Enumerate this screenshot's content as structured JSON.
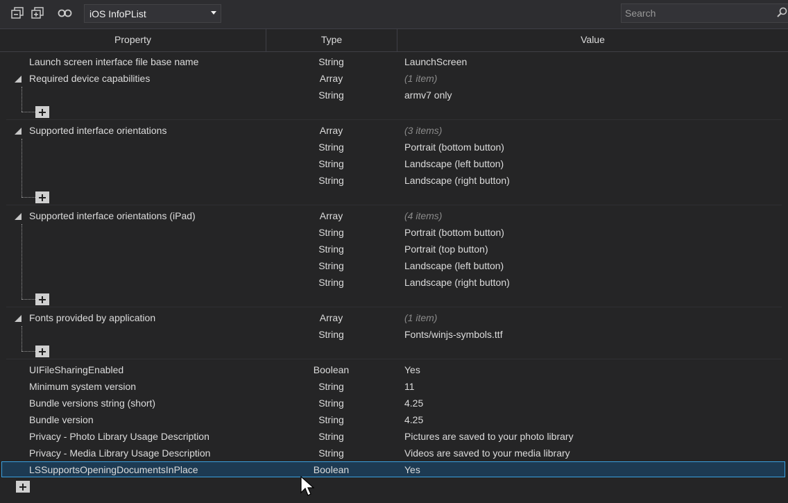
{
  "toolbar": {
    "icons": [
      "collapse-all-icon",
      "expand-all-icon",
      "entitlements-icon"
    ],
    "dropdown_value": "iOS InfoPList",
    "search_placeholder": "Search"
  },
  "columns": {
    "property": "Property",
    "type": "Type",
    "value": "Value"
  },
  "rows": {
    "r0": {
      "property": "Launch screen interface file base name",
      "type": "String",
      "value": "LaunchScreen"
    },
    "r1": {
      "property": "Required device capabilities",
      "type": "Array",
      "value": "(1 item)"
    },
    "r2": {
      "property": "",
      "type": "String",
      "value": "armv7 only"
    },
    "r3": {
      "property": "Supported interface orientations",
      "type": "Array",
      "value": "(3 items)"
    },
    "r4": {
      "property": "",
      "type": "String",
      "value": "Portrait (bottom button)"
    },
    "r5": {
      "property": "",
      "type": "String",
      "value": "Landscape (left button)"
    },
    "r6": {
      "property": "",
      "type": "String",
      "value": "Landscape (right button)"
    },
    "r7": {
      "property": "Supported interface orientations (iPad)",
      "type": "Array",
      "value": "(4 items)"
    },
    "r8": {
      "property": "",
      "type": "String",
      "value": "Portrait (bottom button)"
    },
    "r9": {
      "property": "",
      "type": "String",
      "value": "Portrait (top button)"
    },
    "r10": {
      "property": "",
      "type": "String",
      "value": "Landscape (left button)"
    },
    "r11": {
      "property": "",
      "type": "String",
      "value": "Landscape (right button)"
    },
    "r12": {
      "property": "Fonts provided by application",
      "type": "Array",
      "value": "(1 item)"
    },
    "r13": {
      "property": "",
      "type": "String",
      "value": "Fonts/winjs-symbols.ttf"
    },
    "r14": {
      "property": "UIFileSharingEnabled",
      "type": "Boolean",
      "value": "Yes"
    },
    "r15": {
      "property": "Minimum system version",
      "type": "String",
      "value": "11"
    },
    "r16": {
      "property": "Bundle versions string (short)",
      "type": "String",
      "value": "4.25"
    },
    "r17": {
      "property": "Bundle version",
      "type": "String",
      "value": "4.25"
    },
    "r18": {
      "property": "Privacy - Photo Library Usage Description",
      "type": "String",
      "value": "Pictures are saved to your photo library"
    },
    "r19": {
      "property": "Privacy - Media Library Usage Description",
      "type": "String",
      "value": "Videos are saved to your media library"
    },
    "r20": {
      "property": "LSSupportsOpeningDocumentsInPlace",
      "type": "Boolean",
      "value": "Yes"
    }
  },
  "colors": {
    "background": "#252526",
    "selection": "#1d3a52",
    "selection_border": "#3aa0e0",
    "text": "#dcdcdc",
    "muted": "#8a8a8a"
  }
}
